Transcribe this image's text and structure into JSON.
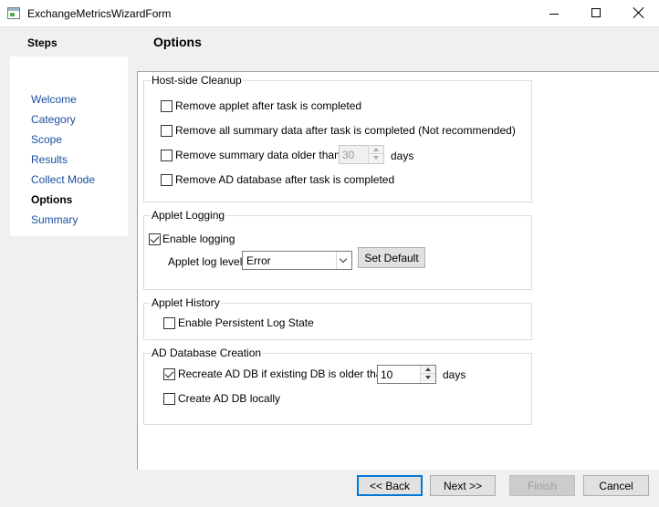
{
  "window": {
    "title": "ExchangeMetricsWizardForm",
    "controls": {
      "minimize_icon": "minimize-icon",
      "maximize_icon": "maximize-icon",
      "close_icon": "close-icon"
    }
  },
  "steps": {
    "title": "Steps",
    "items": [
      {
        "label": "Welcome",
        "active": false
      },
      {
        "label": "Category",
        "active": false
      },
      {
        "label": "Scope",
        "active": false
      },
      {
        "label": "Results",
        "active": false
      },
      {
        "label": "Collect Mode",
        "active": false
      },
      {
        "label": "Options",
        "active": true
      },
      {
        "label": "Summary",
        "active": false
      }
    ]
  },
  "page": {
    "title": "Options"
  },
  "host_cleanup": {
    "legend": "Host-side Cleanup",
    "remove_applet": {
      "label": "Remove applet after task is completed",
      "checked": false
    },
    "remove_summary_all": {
      "label": "Remove all summary data after task is completed (Not recommended)",
      "checked": false
    },
    "remove_summary_older": {
      "label": "Remove summary data older than",
      "checked": false,
      "value": "30",
      "unit": "days",
      "enabled": false
    },
    "remove_ad_db": {
      "label": "Remove AD database after task is completed",
      "checked": false
    }
  },
  "applet_logging": {
    "legend": "Applet Logging",
    "enable_logging": {
      "label": "Enable logging",
      "checked": true
    },
    "log_level_label": "Applet log level",
    "log_level_value": "Error",
    "set_default_label": "Set Default"
  },
  "applet_history": {
    "legend": "Applet History",
    "persistent_log": {
      "label": "Enable Persistent Log State",
      "checked": false
    }
  },
  "ad_db_creation": {
    "legend": "AD Database Creation",
    "recreate": {
      "label": "Recreate AD DB if existing DB is older than",
      "checked": true,
      "value": "10",
      "unit": "days"
    },
    "create_locally": {
      "label": "Create AD DB locally",
      "checked": false
    }
  },
  "footer": {
    "back_label": "<< Back",
    "next_label": "Next >>",
    "finish_label": "Finish",
    "cancel_label": "Cancel"
  },
  "colors": {
    "link": "#1a4fa0",
    "default_button_border": "#0078d7",
    "panel_bg": "#f0f0f0",
    "content_bg": "#ffffff"
  }
}
